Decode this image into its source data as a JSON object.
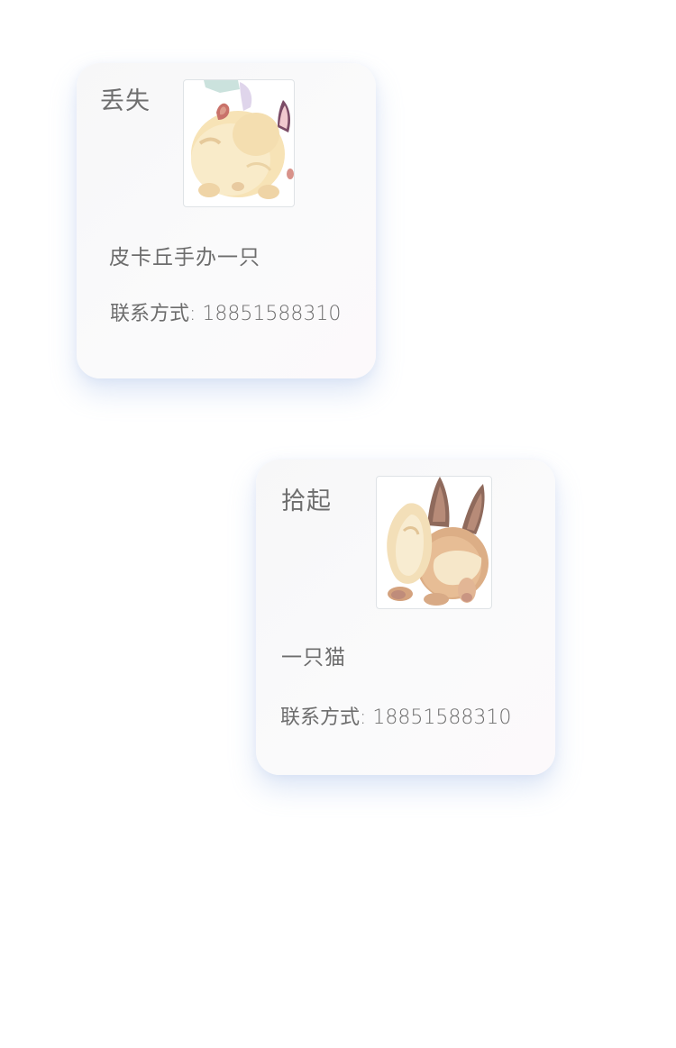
{
  "posts": [
    {
      "type": "丢失",
      "image_icon": "pikachu-figure-image",
      "description": "皮卡丘手办一只",
      "contact_label": "联系方式:",
      "contact_value": "18851588310"
    },
    {
      "type": "拾起",
      "image_icon": "eevee-cat-image",
      "description": "一只猫",
      "contact_label": "联系方式:",
      "contact_value": "18851588310"
    }
  ],
  "colors": {
    "text": "#6d6d6d",
    "card_shadow": "#96b4e6",
    "card_background": "#f8f8f9"
  }
}
